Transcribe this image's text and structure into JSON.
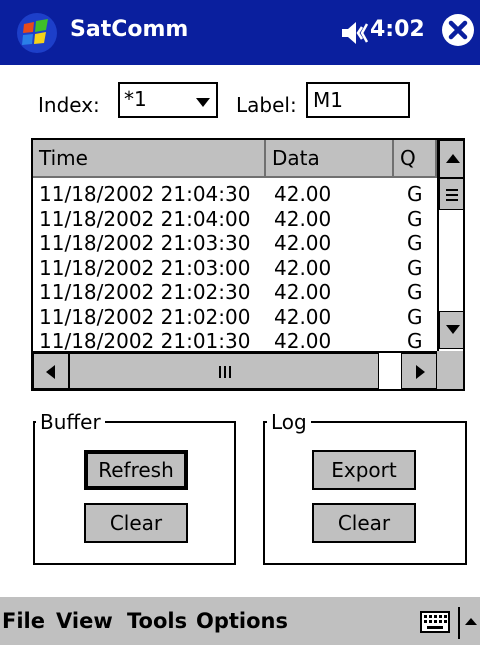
{
  "titlebar": {
    "app_title": "SatComm",
    "clock": "4:02",
    "start_icon": "windows-flag-icon",
    "volume_icon": "speaker-icon",
    "close_icon": "close-icon"
  },
  "form": {
    "index_label": "Index:",
    "index_value": "*1",
    "label_label": "Label:",
    "label_value": "M1"
  },
  "table": {
    "columns": [
      "Time",
      "Data",
      "Q"
    ],
    "rows": [
      {
        "time": "11/18/2002 21:04:30",
        "data": "42.00",
        "q": "G"
      },
      {
        "time": "11/18/2002 21:04:00",
        "data": "42.00",
        "q": "G"
      },
      {
        "time": "11/18/2002 21:03:30",
        "data": "42.00",
        "q": "G"
      },
      {
        "time": "11/18/2002 21:03:00",
        "data": "42.00",
        "q": "G"
      },
      {
        "time": "11/18/2002 21:02:30",
        "data": "42.00",
        "q": "G"
      },
      {
        "time": "11/18/2002 21:02:00",
        "data": "42.00",
        "q": "G"
      },
      {
        "time": "11/18/2002 21:01:30",
        "data": "42.00",
        "q": "G"
      }
    ]
  },
  "buffer": {
    "title": "Buffer",
    "refresh_label": "Refresh",
    "clear_label": "Clear"
  },
  "log": {
    "title": "Log",
    "export_label": "Export",
    "clear_label": "Clear"
  },
  "menu": {
    "items": [
      "File",
      "View",
      "Tools",
      "Options"
    ],
    "keyboard_icon": "keyboard-icon",
    "sip_icon": "chevron-up-icon"
  },
  "colors": {
    "titlebar": "#0a1f9e",
    "chrome": "#c0c0c0"
  }
}
